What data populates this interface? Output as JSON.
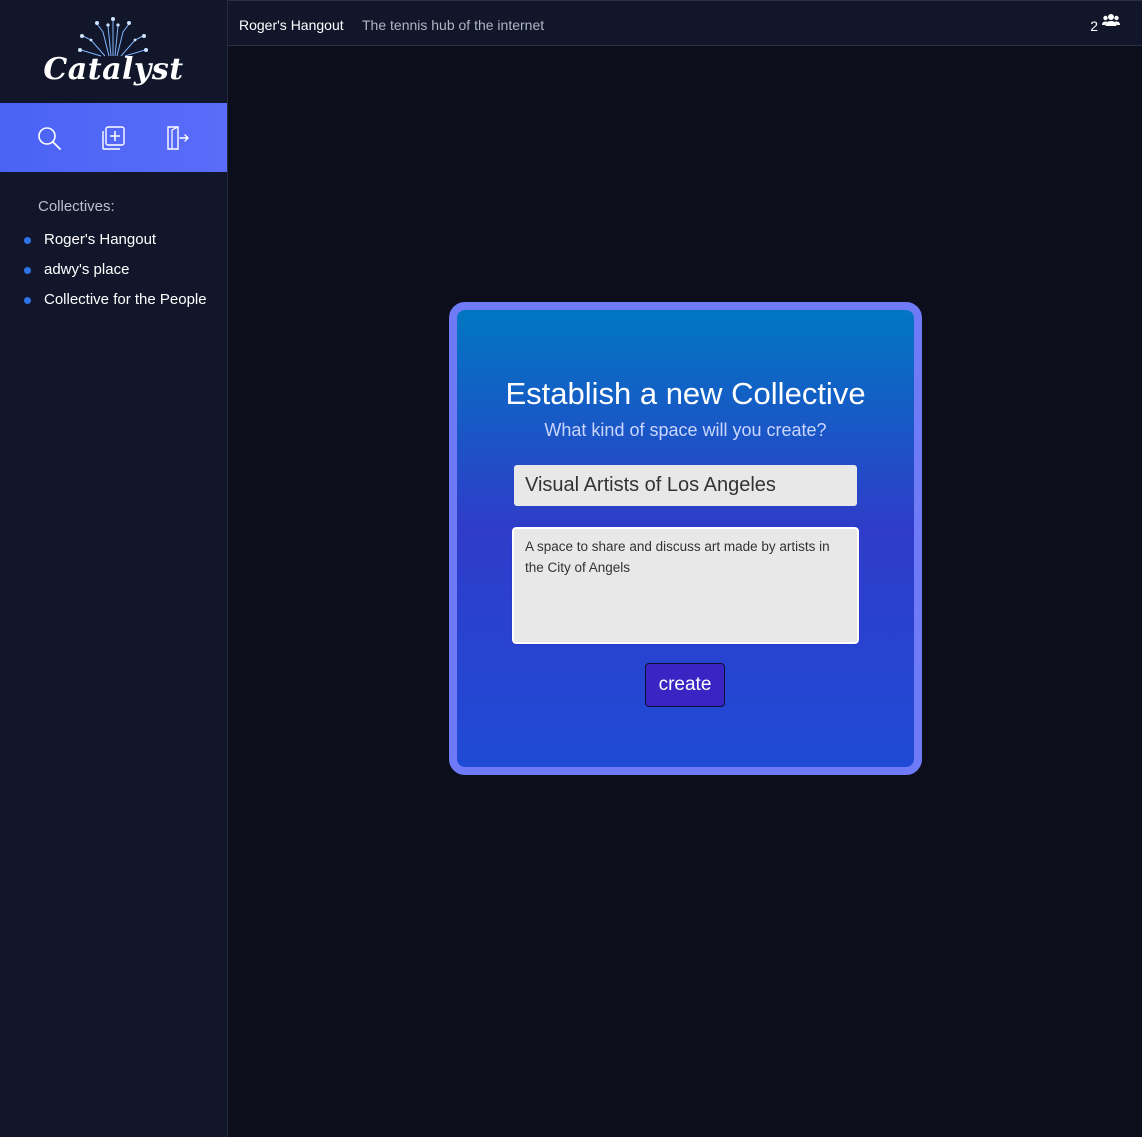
{
  "app": {
    "logo_text": "Catalyst"
  },
  "toolbar": {
    "icons": [
      "search-icon",
      "add-collective-icon",
      "logout-icon"
    ]
  },
  "sidebar": {
    "collectives_label": "Collectives:",
    "items": [
      {
        "label": "Roger's Hangout"
      },
      {
        "label": "adwy's place"
      },
      {
        "label": "Collective for the People"
      }
    ]
  },
  "topbar": {
    "title": "Roger's Hangout",
    "subtitle": "The tennis hub of the internet",
    "member_count": "2"
  },
  "modal": {
    "title": "Establish a new Collective",
    "subtitle": "What kind of space will you create?",
    "name_value": "Visual Artists of Los Angeles",
    "description_value": "A space to share and discuss art made by artists in the City of Angels",
    "create_label": "create"
  },
  "colors": {
    "background": "#0c0f1b",
    "sidebar": "#11162a",
    "toolbar_accent": "#4a63f5",
    "card_border": "#6f7bf6",
    "button": "#3a24c4",
    "bullet": "#2f73e8"
  }
}
